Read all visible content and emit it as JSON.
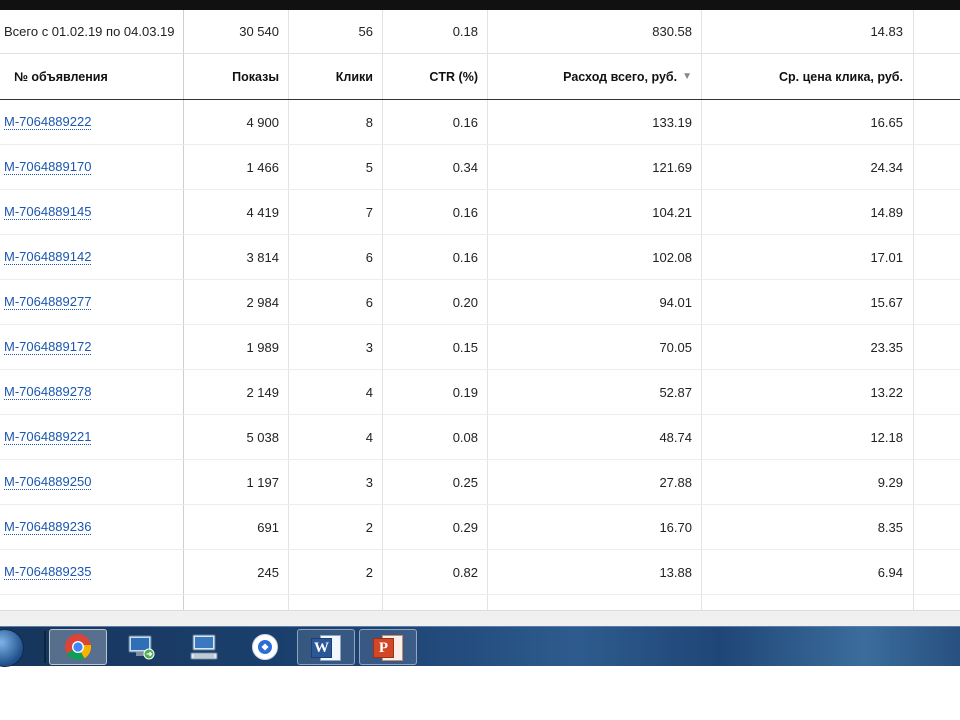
{
  "table": {
    "total": {
      "label": "Всего с 01.02.19 по 04.03.19",
      "shows": "30 540",
      "clicks": "56",
      "ctr": "0.18",
      "spend": "830.58",
      "avg_cpc": "14.83"
    },
    "headers": {
      "ad": "№ объявления",
      "shows": "Показы",
      "clicks": "Клики",
      "ctr": "CTR (%)",
      "spend": "Расход всего, руб.",
      "avg_cpc": "Ср. цена клика, руб."
    },
    "rows": [
      {
        "ad": "M-7064889222",
        "shows": "4 900",
        "clicks": "8",
        "ctr": "0.16",
        "spend": "133.19",
        "avg_cpc": "16.65"
      },
      {
        "ad": "M-7064889170",
        "shows": "1 466",
        "clicks": "5",
        "ctr": "0.34",
        "spend": "121.69",
        "avg_cpc": "24.34"
      },
      {
        "ad": "M-7064889145",
        "shows": "4 419",
        "clicks": "7",
        "ctr": "0.16",
        "spend": "104.21",
        "avg_cpc": "14.89"
      },
      {
        "ad": "M-7064889142",
        "shows": "3 814",
        "clicks": "6",
        "ctr": "0.16",
        "spend": "102.08",
        "avg_cpc": "17.01"
      },
      {
        "ad": "M-7064889277",
        "shows": "2 984",
        "clicks": "6",
        "ctr": "0.20",
        "spend": "94.01",
        "avg_cpc": "15.67"
      },
      {
        "ad": "M-7064889172",
        "shows": "1 989",
        "clicks": "3",
        "ctr": "0.15",
        "spend": "70.05",
        "avg_cpc": "23.35"
      },
      {
        "ad": "M-7064889278",
        "shows": "2 149",
        "clicks": "4",
        "ctr": "0.19",
        "spend": "52.87",
        "avg_cpc": "13.22"
      },
      {
        "ad": "M-7064889221",
        "shows": "5 038",
        "clicks": "4",
        "ctr": "0.08",
        "spend": "48.74",
        "avg_cpc": "12.18"
      },
      {
        "ad": "M-7064889250",
        "shows": "1 197",
        "clicks": "3",
        "ctr": "0.25",
        "spend": "27.88",
        "avg_cpc": "9.29"
      },
      {
        "ad": "M-7064889236",
        "shows": "691",
        "clicks": "2",
        "ctr": "0.29",
        "spend": "16.70",
        "avg_cpc": "8.35"
      },
      {
        "ad": "M-7064889235",
        "shows": "245",
        "clicks": "2",
        "ctr": "0.82",
        "spend": "13.88",
        "avg_cpc": "6.94"
      }
    ],
    "sort_icon": "sort-desc-icon",
    "link_color": "#1a57b0"
  },
  "taskbar": {
    "apps": [
      {
        "name": "chrome-icon",
        "active": true
      },
      {
        "name": "remote-desktop-icon",
        "active": false
      },
      {
        "name": "monitor-keyboard-icon",
        "active": false
      },
      {
        "name": "app-circle-icon",
        "active": false
      },
      {
        "name": "word-icon",
        "active": false
      },
      {
        "name": "powerpoint-icon",
        "active": false
      }
    ],
    "word_letter": "W",
    "ppt_letter": "P"
  }
}
